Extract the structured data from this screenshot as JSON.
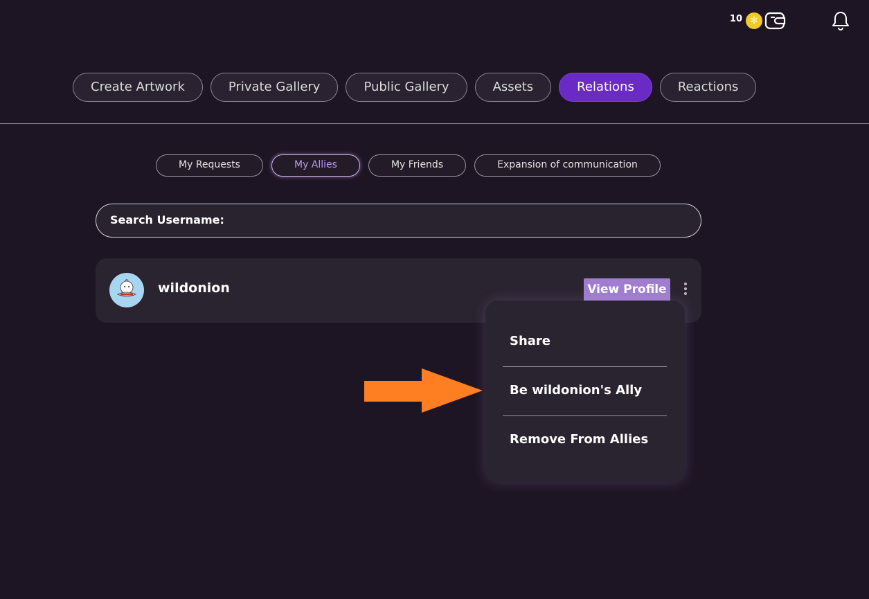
{
  "header": {
    "coin_count": "10",
    "coin_icon": "coin-icon",
    "wallet_icon": "wallet-icon",
    "notification_icon": "bell-icon"
  },
  "main_tabs": [
    {
      "label": "Create Artwork"
    },
    {
      "label": "Private Gallery"
    },
    {
      "label": "Public Gallery"
    },
    {
      "label": "Assets"
    },
    {
      "label": "Relations",
      "active": true
    },
    {
      "label": "Reactions"
    }
  ],
  "sub_tabs": [
    {
      "label": "My Requests"
    },
    {
      "label": "My Allies",
      "active": true
    },
    {
      "label": "My Friends"
    },
    {
      "label": "Expansion of communication"
    }
  ],
  "search": {
    "label": "Search Username:"
  },
  "user_card": {
    "username": "wildonion",
    "view_button": "View Profile"
  },
  "context_menu": {
    "items": [
      {
        "label": "Share"
      },
      {
        "label": "Be wildonion's Ally"
      },
      {
        "label": "Remove From Allies"
      }
    ]
  },
  "colors": {
    "background": "#1e1524",
    "accent": "#6a2ac6",
    "view_button": "#a07dcf",
    "arrow": "#fd7f22",
    "coin": "#f2c925"
  }
}
